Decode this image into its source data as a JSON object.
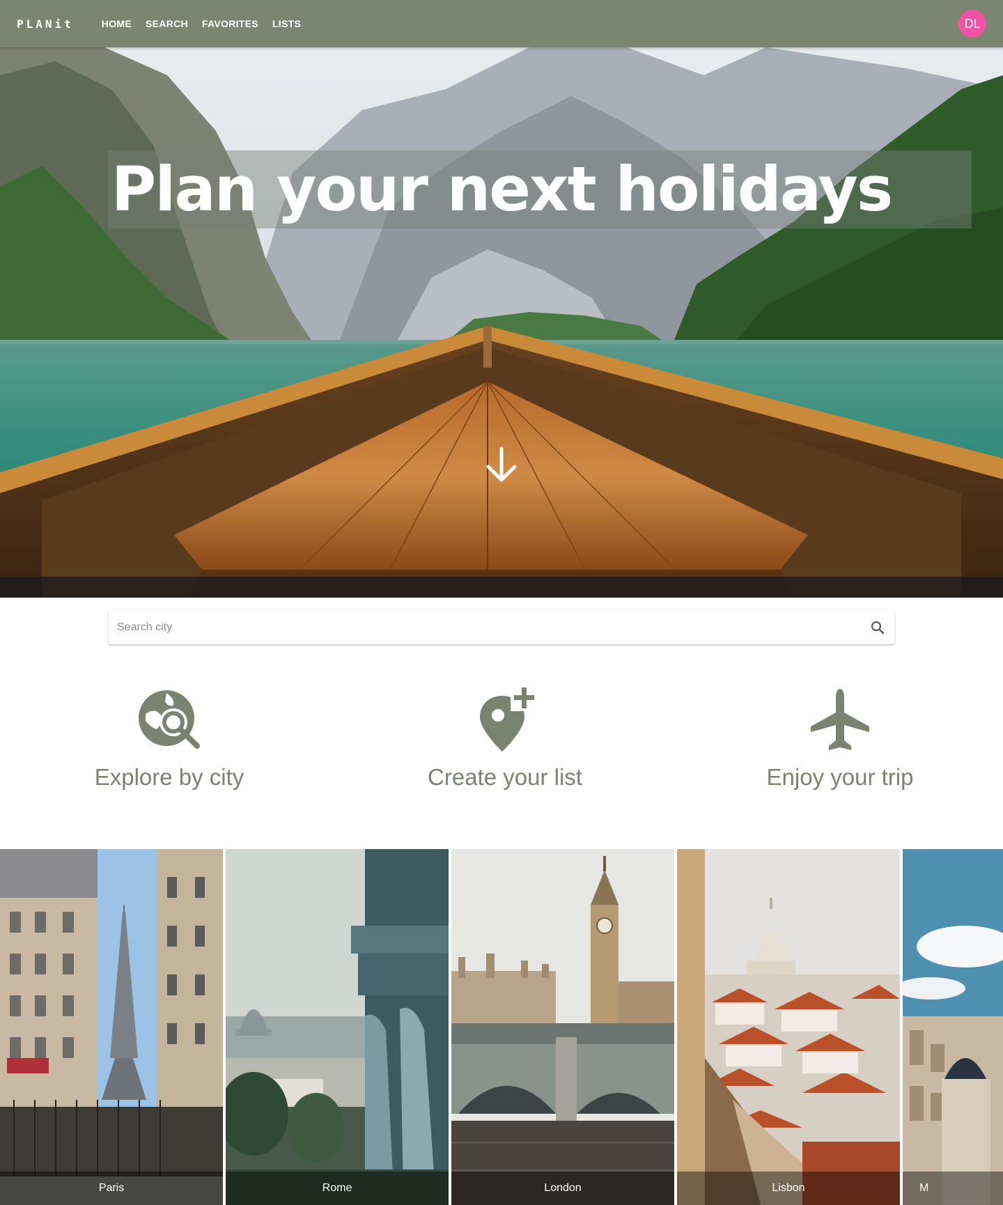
{
  "navbar": {
    "brand": "PLANit",
    "links": [
      "HOME",
      "SEARCH",
      "FAVORITES",
      "LISTS"
    ],
    "avatar_initials": "DL",
    "bg_color": "#7c8571",
    "avatar_color": "#f152a6"
  },
  "hero": {
    "title": "Plan your next holidays",
    "scroll_icon": "arrow-down-icon"
  },
  "search": {
    "placeholder": "Search city",
    "icon": "search-icon"
  },
  "features": [
    {
      "label": "Explore by city",
      "icon": "travel-explore-icon"
    },
    {
      "label": "Create your list",
      "icon": "add-location-icon"
    },
    {
      "label": "Enjoy your trip",
      "icon": "airplane-icon"
    }
  ],
  "cities": [
    "Paris",
    "Rome",
    "London",
    "Lisbon",
    "M"
  ],
  "accent_color": "#7a8270"
}
